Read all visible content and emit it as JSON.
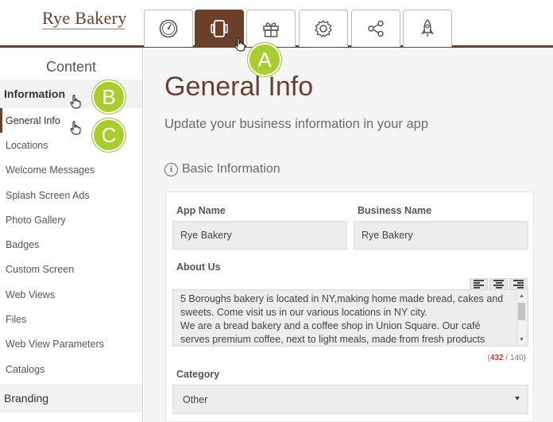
{
  "header": {
    "logo_text": "Rye Bakery",
    "tabs": [
      {
        "icon": "dashboard-icon",
        "active": false
      },
      {
        "icon": "devices-icon",
        "active": true
      },
      {
        "icon": "gift-icon",
        "active": false
      },
      {
        "icon": "gear-icon",
        "active": false
      },
      {
        "icon": "share-icon",
        "active": false
      },
      {
        "icon": "rocket-icon",
        "active": false
      }
    ]
  },
  "sidebar": {
    "title": "Content",
    "section_information": "Information",
    "items": [
      {
        "label": "General Info"
      },
      {
        "label": "Locations"
      },
      {
        "label": "Welcome Messages"
      },
      {
        "label": "Splash Screen Ads"
      },
      {
        "label": "Photo Gallery"
      },
      {
        "label": "Badges"
      },
      {
        "label": "Custom Screen"
      },
      {
        "label": "Web Views"
      },
      {
        "label": "Files"
      },
      {
        "label": "Web View Parameters"
      },
      {
        "label": "Catalogs"
      }
    ],
    "section_branding": "Branding"
  },
  "main": {
    "title": "General Info",
    "subtitle": "Update your business information in your app",
    "section_title": "Basic Information",
    "app_name_label": "App Name",
    "app_name_value": "Rye Bakery",
    "business_name_label": "Business Name",
    "business_name_value": "Rye Bakery",
    "about_label": "About Us",
    "about_line1": "5 Boroughs bakery is located in NY,making home made bread, cakes and",
    "about_line2": "sweets. Come visit us in our various locations in NY city.",
    "about_line3": "We are a bread bakery and a coffee shop in Union Square. Our café",
    "about_line4": "serves premium coffee, next to light meals, made from fresh products",
    "counter_open": "(",
    "counter_current": "432",
    "counter_rest": " / 140)",
    "category_label": "Category",
    "category_value": "Other"
  },
  "annotations": {
    "a": "A",
    "b": "B",
    "c": "C"
  },
  "colors": {
    "brand": "#6b3f2a",
    "badge": "#a9cc2f",
    "over_limit": "#c0392b"
  }
}
